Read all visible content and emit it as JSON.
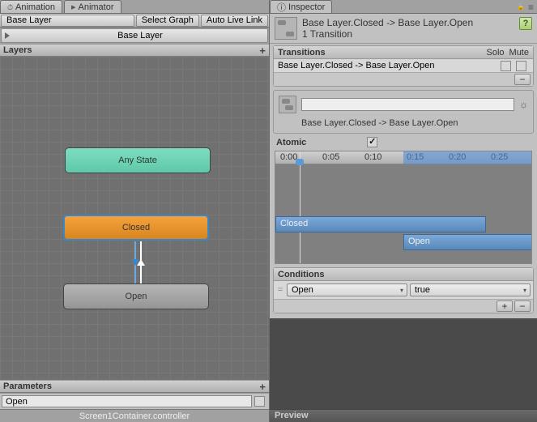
{
  "tabs": {
    "animation": "Animation",
    "animator": "Animator",
    "inspector": "Inspector"
  },
  "toolbar": {
    "breadcrumb": "Base Layer",
    "select_graph": "Select Graph",
    "auto_live_link": "Auto Live Link"
  },
  "layer_row": "Base Layer",
  "sections": {
    "layers": "Layers",
    "parameters": "Parameters"
  },
  "nodes": {
    "any_state": "Any State",
    "closed": "Closed",
    "open": "Open"
  },
  "params": {
    "name": "Open"
  },
  "footer": "Screen1Container.controller",
  "inspector": {
    "title": "Base Layer.Closed -> Base Layer.Open",
    "subtitle": "1 Transition",
    "transitions_hdr": "Transitions",
    "solo": "Solo",
    "mute": "Mute",
    "list_item": "Base Layer.Closed -> Base Layer.Open",
    "name_label": "Base Layer.Closed -> Base Layer.Open",
    "atomic": "Atomic",
    "conditions_hdr": "Conditions",
    "cond_param": "Open",
    "cond_value": "true",
    "preview": "Preview"
  },
  "timeline": {
    "ticks": [
      "0:00",
      "0:05",
      "0:10",
      "0:15",
      "0:20",
      "0:25"
    ],
    "clip_a": "Closed",
    "clip_b": "Open"
  }
}
